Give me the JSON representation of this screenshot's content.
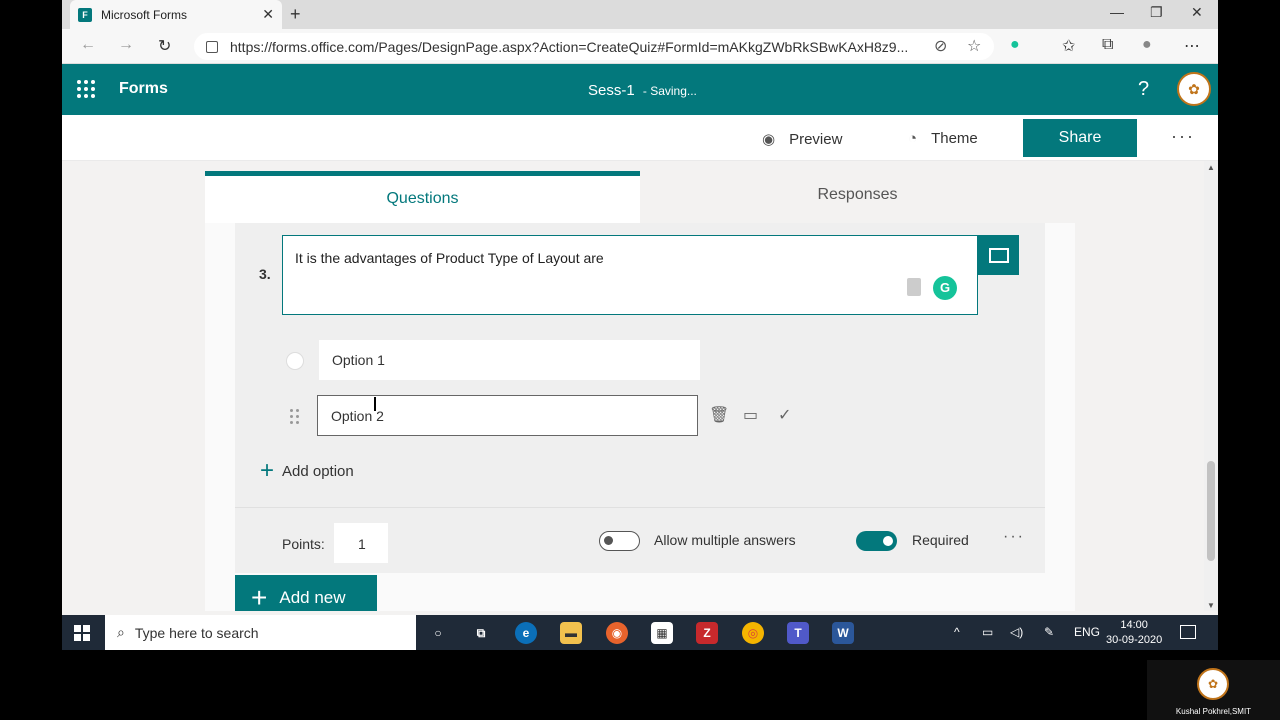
{
  "browser": {
    "tab_title": "Microsoft Forms",
    "url": "https://forms.office.com/Pages/DesignPage.aspx?Action=CreateQuiz#FormId=mAKkgZWbRkSBwKAxH8z9..."
  },
  "app": {
    "name": "Forms",
    "form_title": "Sess-1",
    "status": "- Saving...",
    "help": "?"
  },
  "commands": {
    "preview": "Preview",
    "theme": "Theme",
    "share": "Share",
    "more": "···"
  },
  "tabs": {
    "questions": "Questions",
    "responses": "Responses"
  },
  "question": {
    "number": "3.",
    "text": "It is the advantages of Product Type of Layout are",
    "options": [
      {
        "label": "Option 1"
      },
      {
        "label": "Option 2"
      }
    ],
    "add_option": "Add option",
    "points_label": "Points:",
    "points_value": "1",
    "allow_multiple": "Allow multiple answers",
    "allow_multiple_on": false,
    "required": "Required",
    "required_on": true
  },
  "add_new": "Add new",
  "taskbar": {
    "search_placeholder": "Type here to search",
    "language": "ENG",
    "time": "14:00",
    "date": "30-09-2020"
  },
  "webcam": {
    "name": "Kushal Pokhrel,SMIT"
  },
  "colors": {
    "brand": "#03787c",
    "taskbar": "#1f2a38"
  }
}
